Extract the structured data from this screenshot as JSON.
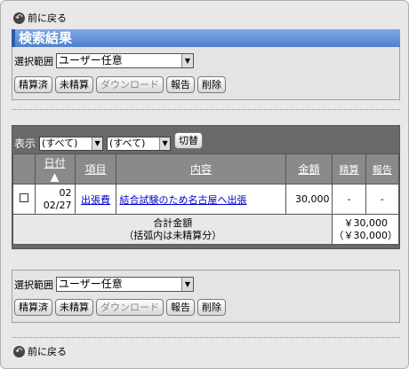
{
  "nav": {
    "back_label": "前に戻る"
  },
  "title": "検索結果",
  "select_range": {
    "label": "選択範囲",
    "value": "ユーザー任意"
  },
  "actions": {
    "settled": "精算済",
    "unsettled": "未精算",
    "download": "ダウンロード",
    "report": "報告",
    "delete": "削除"
  },
  "display": {
    "label": "表示",
    "filter1": "(すべて)",
    "filter2": "(すべて)",
    "switch": "切替"
  },
  "table": {
    "headers": {
      "date": "日付",
      "item": "項目",
      "content": "内容",
      "amount": "金額",
      "settled": "精算",
      "report": "報告"
    },
    "sort_indicator": "▲",
    "rows": [
      {
        "date_line1": "02",
        "date_line2": "02/27",
        "item": "出張費",
        "content": "結合試験のため名古屋へ出張",
        "amount": "30,000",
        "settled": "-",
        "report": "-"
      }
    ],
    "total": {
      "label1": "合計金額",
      "label2": "（括弧内は未精算分）",
      "amount1": "￥30,000",
      "amount2": "（￥30,000）"
    }
  }
}
